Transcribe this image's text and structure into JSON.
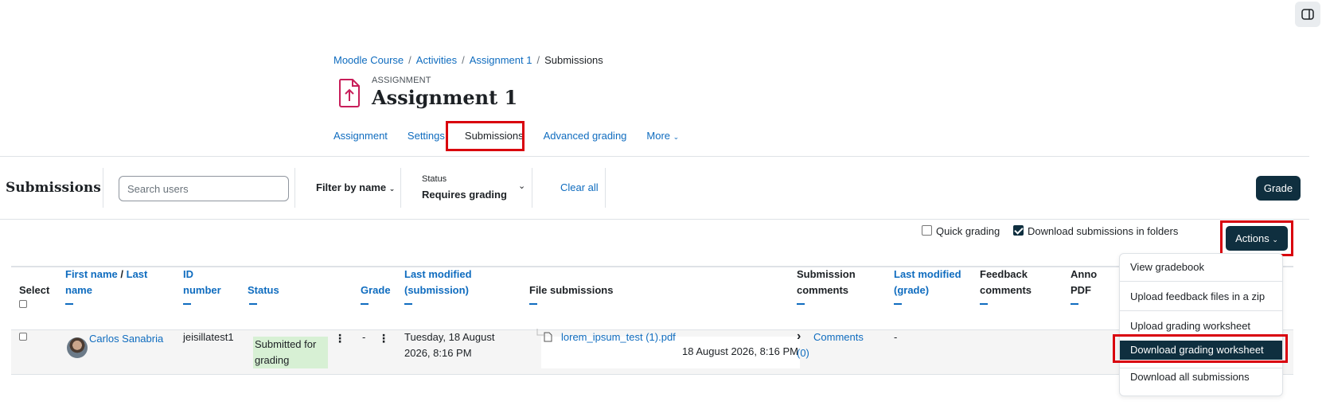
{
  "breadcrumb": [
    "Moodle Course",
    "Activities",
    "Assignment 1",
    "Submissions"
  ],
  "header": {
    "type_label": "ASSIGNMENT",
    "title": "Assignment 1"
  },
  "secondary_nav": [
    "Assignment",
    "Settings",
    "Submissions",
    "Advanced grading",
    "More"
  ],
  "toolbar": {
    "heading": "Submissions",
    "search_placeholder": "Search users",
    "filter_by_name": "Filter by name",
    "status_label": "Status",
    "status_value": "Requires grading",
    "clear_all": "Clear all",
    "grade_button": "Grade"
  },
  "options": {
    "quick_grading": "Quick grading",
    "download_in_folders": "Download submissions in folders",
    "actions_button": "Actions"
  },
  "table": {
    "headers": {
      "select": "Select",
      "first_name": "First name",
      "slash": "/",
      "last_name": "Last name",
      "id_number": "ID number",
      "status": "Status",
      "grade": "Grade",
      "last_modified_submission": "Last modified (submission)",
      "file_submissions": "File submissions",
      "submission_comments": "Submission comments",
      "last_modified_grade": "Last modified (grade)",
      "feedback_comments": "Feedback comments",
      "annotate_pdf": "Anno PDF"
    },
    "rows": [
      {
        "name": "Carlos Sanabria",
        "id_number": "jeisillatest1",
        "status": "Submitted for grading",
        "grade": "-",
        "last_modified": "Tuesday, 18 August 2026, 8:16 PM",
        "file_name": "lorem_ipsum_test (1).pdf",
        "file_date": "18 August 2026, 8:16 PM",
        "comments": "Comments (0)",
        "last_modified_grade": "-"
      }
    ]
  },
  "actions_menu": [
    "View gradebook",
    "Upload feedback files in a zip",
    "Upload grading worksheet",
    "Download grading worksheet",
    "Download all submissions"
  ],
  "colors": {
    "highlight": "#d9000d",
    "primary_dark": "#0f2f3f",
    "link": "#0f6cbf",
    "status_submitted": "#d7f0d4",
    "assignment_icon": "#c81e5a"
  }
}
